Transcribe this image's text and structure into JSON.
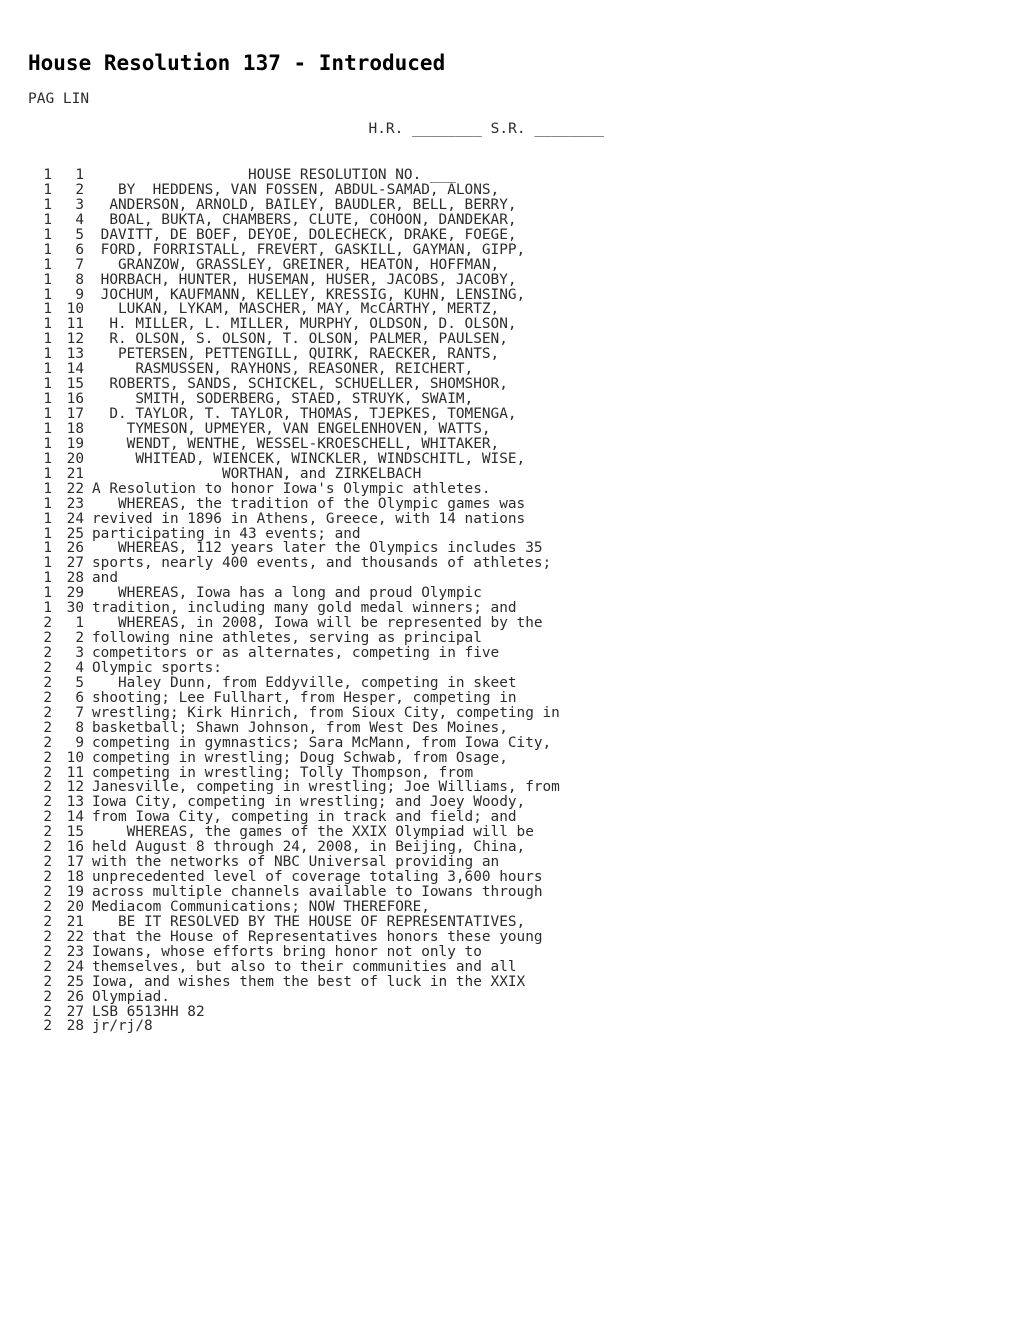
{
  "document": {
    "title": "House Resolution 137 - Introduced",
    "column_header": "PAG LIN",
    "blanks_line": "                                       H.R. ________ S.R. ________"
  },
  "body_lines": [
    {
      "page": "1",
      "line": "1",
      "text": "                  HOUSE RESOLUTION NO. ___"
    },
    {
      "page": "1",
      "line": "2",
      "text": "   BY  HEDDENS, VAN FOSSEN, ABDUL-SAMAD, ALONS,"
    },
    {
      "page": "1",
      "line": "3",
      "text": "  ANDERSON, ARNOLD, BAILEY, BAUDLER, BELL, BERRY,"
    },
    {
      "page": "1",
      "line": "4",
      "text": "  BOAL, BUKTA, CHAMBERS, CLUTE, COHOON, DANDEKAR,"
    },
    {
      "page": "1",
      "line": "5",
      "text": " DAVITT, DE BOEF, DEYOE, DOLECHECK, DRAKE, FOEGE,"
    },
    {
      "page": "1",
      "line": "6",
      "text": " FORD, FORRISTALL, FREVERT, GASKILL, GAYMAN, GIPP,"
    },
    {
      "page": "1",
      "line": "7",
      "text": "   GRANZOW, GRASSLEY, GREINER, HEATON, HOFFMAN,"
    },
    {
      "page": "1",
      "line": "8",
      "text": " HORBACH, HUNTER, HUSEMAN, HUSER, JACOBS, JACOBY,"
    },
    {
      "page": "1",
      "line": "9",
      "text": " JOCHUM, KAUFMANN, KELLEY, KRESSIG, KUHN, LENSING,"
    },
    {
      "page": "1",
      "line": "10",
      "text": "   LUKAN, LYKAM, MASCHER, MAY, McCARTHY, MERTZ,"
    },
    {
      "page": "1",
      "line": "11",
      "text": "  H. MILLER, L. MILLER, MURPHY, OLDSON, D. OLSON,"
    },
    {
      "page": "1",
      "line": "12",
      "text": "  R. OLSON, S. OLSON, T. OLSON, PALMER, PAULSEN,"
    },
    {
      "page": "1",
      "line": "13",
      "text": "   PETERSEN, PETTENGILL, QUIRK, RAECKER, RANTS,"
    },
    {
      "page": "1",
      "line": "14",
      "text": "     RASMUSSEN, RAYHONS, REASONER, REICHERT,"
    },
    {
      "page": "1",
      "line": "15",
      "text": "  ROBERTS, SANDS, SCHICKEL, SCHUELLER, SHOMSHOR,"
    },
    {
      "page": "1",
      "line": "16",
      "text": "     SMITH, SODERBERG, STAED, STRUYK, SWAIM,"
    },
    {
      "page": "1",
      "line": "17",
      "text": "  D. TAYLOR, T. TAYLOR, THOMAS, TJEPKES, TOMENGA,"
    },
    {
      "page": "1",
      "line": "18",
      "text": "    TYMESON, UPMEYER, VAN ENGELENHOVEN, WATTS,"
    },
    {
      "page": "1",
      "line": "19",
      "text": "    WENDT, WENTHE, WESSEL-KROESCHELL, WHITAKER,"
    },
    {
      "page": "1",
      "line": "20",
      "text": "     WHITEAD, WIENCEK, WINCKLER, WINDSCHITL, WISE,"
    },
    {
      "page": "1",
      "line": "21",
      "text": "               WORTHAN, and ZIRKELBACH"
    },
    {
      "page": "1",
      "line": "22",
      "text": "A Resolution to honor Iowa's Olympic athletes."
    },
    {
      "page": "1",
      "line": "23",
      "text": "   WHEREAS, the tradition of the Olympic games was"
    },
    {
      "page": "1",
      "line": "24",
      "text": "revived in 1896 in Athens, Greece, with 14 nations"
    },
    {
      "page": "1",
      "line": "25",
      "text": "participating in 43 events; and"
    },
    {
      "page": "1",
      "line": "26",
      "text": "   WHEREAS, 112 years later the Olympics includes 35"
    },
    {
      "page": "1",
      "line": "27",
      "text": "sports, nearly 400 events, and thousands of athletes;"
    },
    {
      "page": "1",
      "line": "28",
      "text": "and"
    },
    {
      "page": "1",
      "line": "29",
      "text": "   WHEREAS, Iowa has a long and proud Olympic"
    },
    {
      "page": "1",
      "line": "30",
      "text": "tradition, including many gold medal winners; and"
    },
    {
      "page": "2",
      "line": "1",
      "text": "   WHEREAS, in 2008, Iowa will be represented by the"
    },
    {
      "page": "2",
      "line": "2",
      "text": "following nine athletes, serving as principal"
    },
    {
      "page": "2",
      "line": "3",
      "text": "competitors or as alternates, competing in five"
    },
    {
      "page": "2",
      "line": "4",
      "text": "Olympic sports:"
    },
    {
      "page": "2",
      "line": "5",
      "text": "   Haley Dunn, from Eddyville, competing in skeet"
    },
    {
      "page": "2",
      "line": "6",
      "text": "shooting; Lee Fullhart, from Hesper, competing in"
    },
    {
      "page": "2",
      "line": "7",
      "text": "wrestling; Kirk Hinrich, from Sioux City, competing in"
    },
    {
      "page": "2",
      "line": "8",
      "text": "basketball; Shawn Johnson, from West Des Moines,"
    },
    {
      "page": "2",
      "line": "9",
      "text": "competing in gymnastics; Sara McMann, from Iowa City,"
    },
    {
      "page": "2",
      "line": "10",
      "text": "competing in wrestling; Doug Schwab, from Osage,"
    },
    {
      "page": "2",
      "line": "11",
      "text": "competing in wrestling; Tolly Thompson, from"
    },
    {
      "page": "2",
      "line": "12",
      "text": "Janesville, competing in wrestling; Joe Williams, from"
    },
    {
      "page": "2",
      "line": "13",
      "text": "Iowa City, competing in wrestling; and Joey Woody,"
    },
    {
      "page": "2",
      "line": "14",
      "text": "from Iowa City, competing in track and field; and"
    },
    {
      "page": "2",
      "line": "15",
      "text": "    WHEREAS, the games of the XXIX Olympiad will be"
    },
    {
      "page": "2",
      "line": "16",
      "text": "held August 8 through 24, 2008, in Beijing, China,"
    },
    {
      "page": "2",
      "line": "17",
      "text": "with the networks of NBC Universal providing an"
    },
    {
      "page": "2",
      "line": "18",
      "text": "unprecedented level of coverage totaling 3,600 hours"
    },
    {
      "page": "2",
      "line": "19",
      "text": "across multiple channels available to Iowans through"
    },
    {
      "page": "2",
      "line": "20",
      "text": "Mediacom Communications; NOW THEREFORE,"
    },
    {
      "page": "2",
      "line": "21",
      "text": "   BE IT RESOLVED BY THE HOUSE OF REPRESENTATIVES,"
    },
    {
      "page": "2",
      "line": "22",
      "text": "that the House of Representatives honors these young"
    },
    {
      "page": "2",
      "line": "23",
      "text": "Iowans, whose efforts bring honor not only to"
    },
    {
      "page": "2",
      "line": "24",
      "text": "themselves, but also to their communities and all"
    },
    {
      "page": "2",
      "line": "25",
      "text": "Iowa, and wishes them the best of luck in the XXIX"
    },
    {
      "page": "2",
      "line": "26",
      "text": "Olympiad."
    },
    {
      "page": "2",
      "line": "27",
      "text": "LSB 6513HH 82"
    },
    {
      "page": "2",
      "line": "28",
      "text": "jr/rj/8"
    }
  ]
}
